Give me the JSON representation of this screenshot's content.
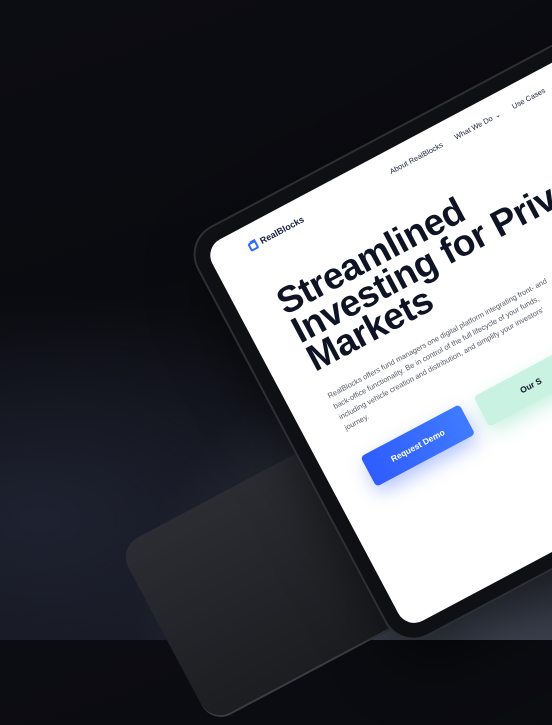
{
  "brand": {
    "name": "RealBlocks"
  },
  "nav": {
    "items": [
      {
        "label": "About RealBlocks"
      },
      {
        "label": "What We Do"
      },
      {
        "label": "Use Cases"
      }
    ]
  },
  "hero": {
    "title_lines": [
      "Streamlined",
      "Investing for Priva",
      "Markets"
    ],
    "description": "RealBlocks offers fund managers one digital platform integrating front- and back-office functionality. Be in control of the full lifecycle of your funds, including vehicle creation and distribution, and simplify your investors' journey.",
    "primary_button": "Request Demo",
    "secondary_button": "Our S"
  },
  "colors": {
    "accent": "#2f5cff",
    "mint": "#c9f2e2",
    "title": "#0f1424"
  },
  "icons": {
    "logo": "logo-mark-icon",
    "chevron": "chevron-down-icon"
  }
}
